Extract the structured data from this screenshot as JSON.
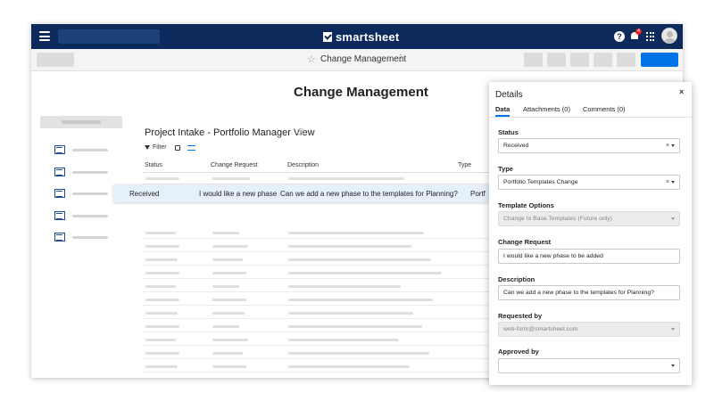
{
  "app": {
    "brand": "smartsheet",
    "sheet_name": "Change Management",
    "notification_count": "4",
    "accent": "#0073e6",
    "topbar_color": "#0c2a5b"
  },
  "icons": {
    "help": "?",
    "star": "☆",
    "kebab": "⋮",
    "info": "i",
    "close": "×"
  },
  "dashboard": {
    "title": "Change Management"
  },
  "report": {
    "title": "Project Intake - Portfolio Manager View",
    "filter_label": "Filter",
    "columns": [
      "Status",
      "Change Request",
      "Description",
      "Type"
    ],
    "highlight_row": {
      "status": "Received",
      "change_request": "I would like a new phase",
      "description": "Can we add a new phase to the templates for Planning?",
      "type": "Portf"
    }
  },
  "details": {
    "title": "Details",
    "tabs": [
      "Data",
      "Attachments (0)",
      "Comments (0)"
    ],
    "fields": {
      "status": {
        "label": "Status",
        "value": "Received"
      },
      "type": {
        "label": "Type",
        "value": "Portfolio Templates Change"
      },
      "template_options": {
        "label": "Template Options",
        "value": "Change to Base Templates (Future only)"
      },
      "change_request": {
        "label": "Change Request",
        "value": "I would like a new phase to be added"
      },
      "description": {
        "label": "Description",
        "value": "Can we add a new phase to the templates for Planning?"
      },
      "requested_by": {
        "label": "Requested by",
        "value": "web-form@smartsheet.com"
      },
      "approved_by": {
        "label": "Approved by",
        "value": ""
      }
    }
  }
}
